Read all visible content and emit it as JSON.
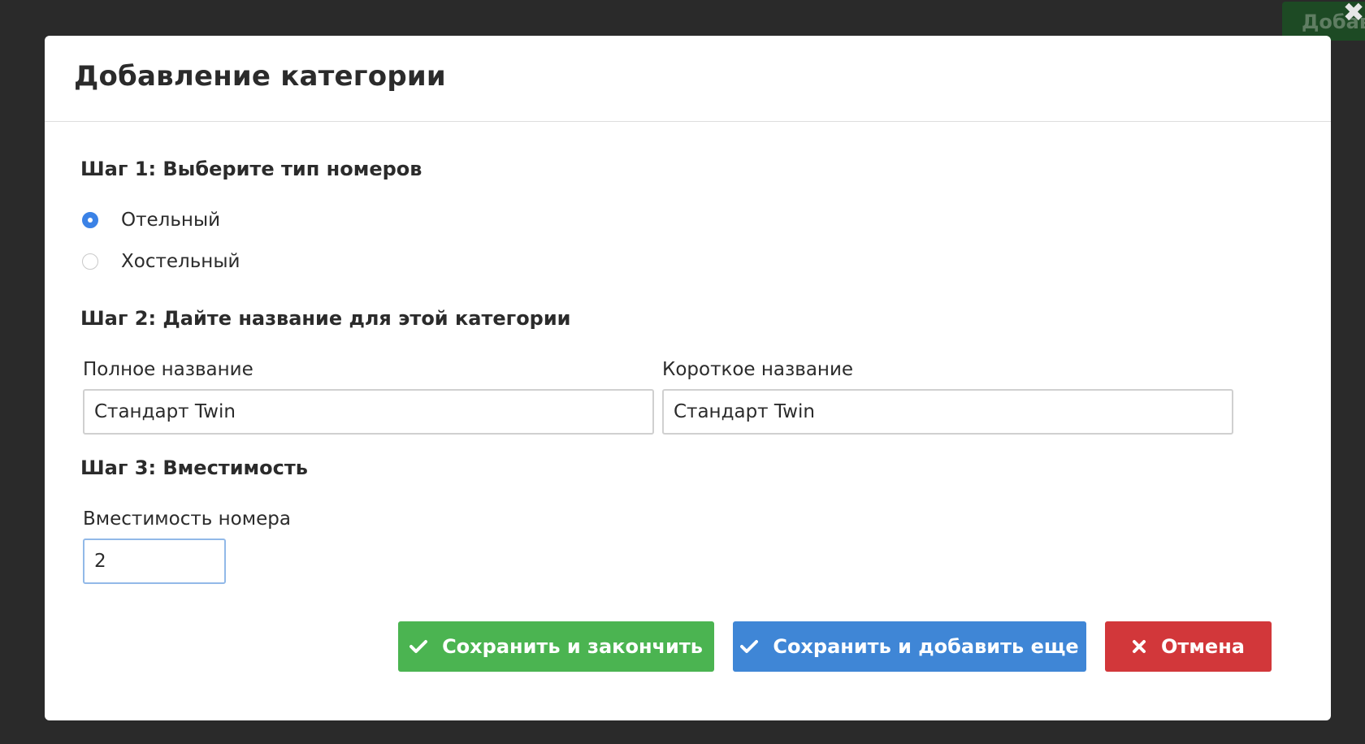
{
  "background": {
    "button_label": "Добавить",
    "close_icon": "close-icon"
  },
  "modal": {
    "title": "Добавление категории",
    "step1": {
      "title": "Шаг 1: Выберите тип номеров",
      "options": [
        {
          "label": "Отельный",
          "checked": true
        },
        {
          "label": "Хостельный",
          "checked": false
        }
      ]
    },
    "step2": {
      "title": "Шаг 2: Дайте название для этой категории",
      "full_name_label": "Полное название",
      "full_name_value": "Стандарт Twin",
      "short_name_label": "Короткое название",
      "short_name_value": "Стандарт Twin"
    },
    "step3": {
      "title": "Шаг 3: Вместимость",
      "capacity_label": "Вместимость номера",
      "capacity_value": "2"
    },
    "buttons": {
      "save_finish": "Сохранить и закончить",
      "save_add": "Сохранить и добавить еще",
      "cancel": "Отмена"
    }
  },
  "colors": {
    "green": "#4bb451",
    "blue": "#3f86d6",
    "red": "#d2373a",
    "radio_accent": "#3b82e6"
  }
}
